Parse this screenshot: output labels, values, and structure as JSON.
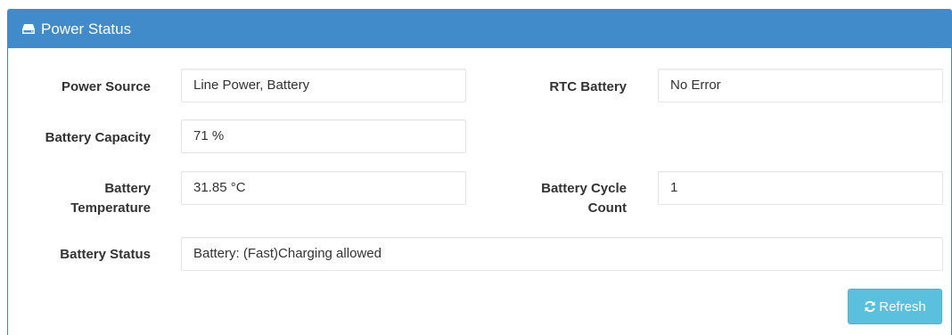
{
  "panel": {
    "title": "Power Status",
    "title_icon": "hdd-icon"
  },
  "fields": {
    "power_source": {
      "label": "Power Source",
      "value": "Line Power, Battery"
    },
    "rtc_battery": {
      "label": "RTC Battery",
      "value": "No Error"
    },
    "battery_capacity": {
      "label": "Battery Capacity",
      "value": "71 %"
    },
    "battery_temperature": {
      "label_line1": "Battery",
      "label_line2": "Temperature",
      "value": "31.85 °C"
    },
    "battery_cycle_count": {
      "label_line1": "Battery Cycle",
      "label_line2": "Count",
      "value": "1"
    },
    "battery_status": {
      "label": "Battery Status",
      "value": "Battery: (Fast)Charging allowed"
    }
  },
  "actions": {
    "refresh_label": "Refresh",
    "refresh_icon": "refresh-icon"
  },
  "colors": {
    "header_bg": "#428bca",
    "button_bg": "#5bc0de"
  }
}
